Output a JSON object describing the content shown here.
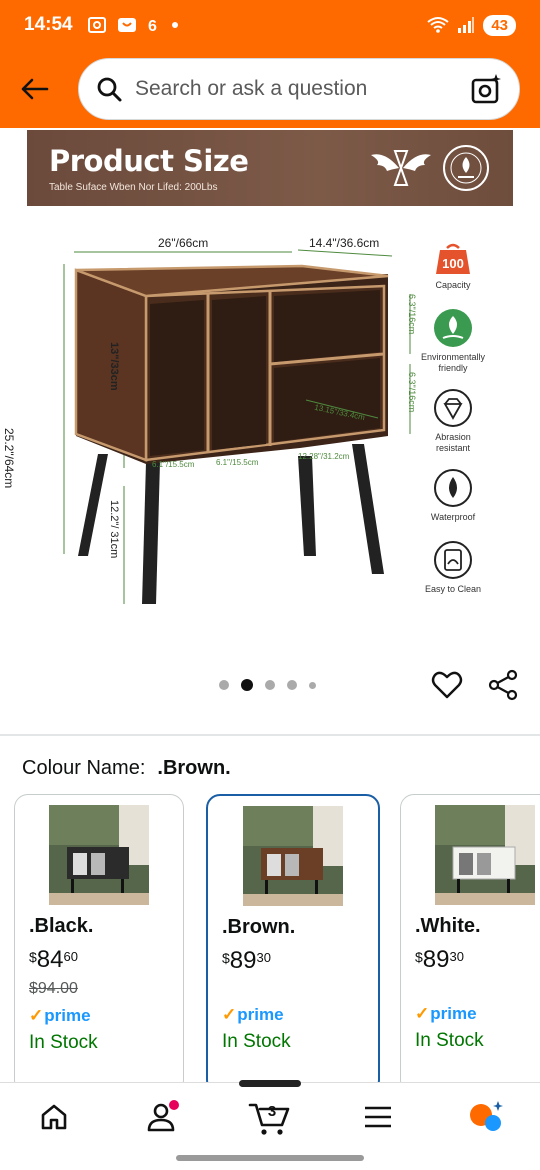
{
  "status_bar": {
    "time": "14:54",
    "left_icons": [
      "screenshot-icon",
      "shopping-icon",
      "app-6-icon",
      "dot-icon"
    ],
    "battery": "43"
  },
  "search": {
    "placeholder": "Search or ask a question"
  },
  "banner": {
    "title": "Product Size",
    "subtitle": "Table Suface Wben Nor Lifed: 200Lbs"
  },
  "dimensions": {
    "width": "26\"/66cm",
    "depth": "14.4\"/36.6cm",
    "total_height": "25.2\"/64cm",
    "cabinet_height": "13\"/33cm",
    "leg_height": "12.2\"/ 31cm",
    "shelf_upper": "6.3\"/16cm",
    "shelf_lower": "6.3\"/16cm",
    "inner_depth": "13.15\"/33.4cm",
    "compartment_1": "6.1\"/15.5cm",
    "compartment_2": "6.1\"/15.5cm",
    "compartment_3": "12.28\"/31.2cm"
  },
  "features": [
    {
      "icon": "weight-100-icon",
      "label": "Capacity",
      "badge": "100"
    },
    {
      "icon": "leaf-icon",
      "label": "Environmentally friendly"
    },
    {
      "icon": "diamond-icon",
      "label": "Abrasion resistant"
    },
    {
      "icon": "water-drop-icon",
      "label": "Waterproof"
    },
    {
      "icon": "clean-icon",
      "label": "Easy to Clean"
    }
  ],
  "carousel": {
    "count": 5,
    "active_index": 1
  },
  "colour": {
    "label": "Colour Name:",
    "value": ".Brown."
  },
  "variants": [
    {
      "name": ".Black.",
      "currency": "$",
      "whole": "84",
      "cents": "60",
      "list_price": "$94.00",
      "prime": "prime",
      "stock": "In Stock",
      "selected": false,
      "color": "#2b2b2b"
    },
    {
      "name": ".Brown.",
      "currency": "$",
      "whole": "89",
      "cents": "30",
      "list_price": "",
      "prime": "prime",
      "stock": "In Stock",
      "selected": true,
      "color": "#5a3a26"
    },
    {
      "name": ".White.",
      "currency": "$",
      "whole": "89",
      "cents": "30",
      "list_price": "",
      "prime": "prime",
      "stock": "In Stock",
      "selected": false,
      "color": "#eeeeea"
    }
  ],
  "bottom_nav": {
    "cart_count": "3",
    "items": [
      "home-icon",
      "account-icon",
      "cart-icon",
      "menu-icon",
      "rufus-icon"
    ]
  },
  "colors": {
    "header": "#ff6a00",
    "selected_border": "#1a5ea6",
    "stock": "#007600",
    "prime": "#1a98ff"
  }
}
